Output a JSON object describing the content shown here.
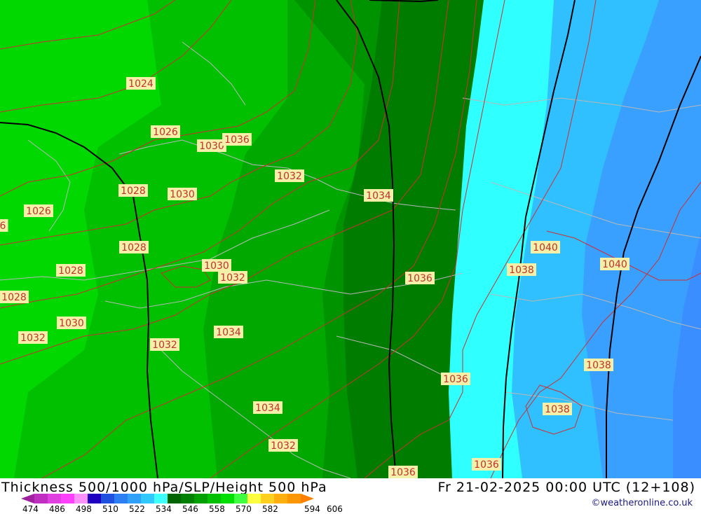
{
  "footer": {
    "title": "Thickness 500/1000 hPa/SLP/Height 500 hPa",
    "valid_time": "Fr 21-02-2025 00:00 UTC (12+108)",
    "credit": "©weatheronline.co.uk"
  },
  "colorscale": {
    "ticks": [
      "474",
      "486",
      "498",
      "510",
      "522",
      "534",
      "546",
      "558",
      "570",
      "582",
      "594",
      "606"
    ],
    "colors": [
      "#a020a0",
      "#c030c0",
      "#e040e0",
      "#ff40ff",
      "#ff90ff",
      "#2000c0",
      "#2050e0",
      "#2c7ff0",
      "#30a0f8",
      "#30c8ff",
      "#40ffff",
      "#006400",
      "#008000",
      "#00a000",
      "#00c000",
      "#00e000",
      "#40ff40",
      "#ffff40",
      "#ffd020",
      "#ffb010",
      "#ff9800",
      "#ff8000"
    ]
  },
  "map": {
    "band_colors": [
      "#00d800",
      "#00c000",
      "#00a800",
      "#009300",
      "#007d00",
      "#30ffff",
      "#30c0ff",
      "#3aa0ff",
      "#3a8eff"
    ],
    "isobar_labels": [
      "1024",
      "1026",
      "1026",
      "1028",
      "1028",
      "1028",
      "1028",
      "1030",
      "1030",
      "1030",
      "1030",
      "1032",
      "1032",
      "1032",
      "1032",
      "1032",
      "1034",
      "1034",
      "1034",
      "1036",
      "1036",
      "1036",
      "1036",
      "1038",
      "1038",
      "1038",
      "1040",
      "1040",
      "1036",
      "6"
    ]
  }
}
